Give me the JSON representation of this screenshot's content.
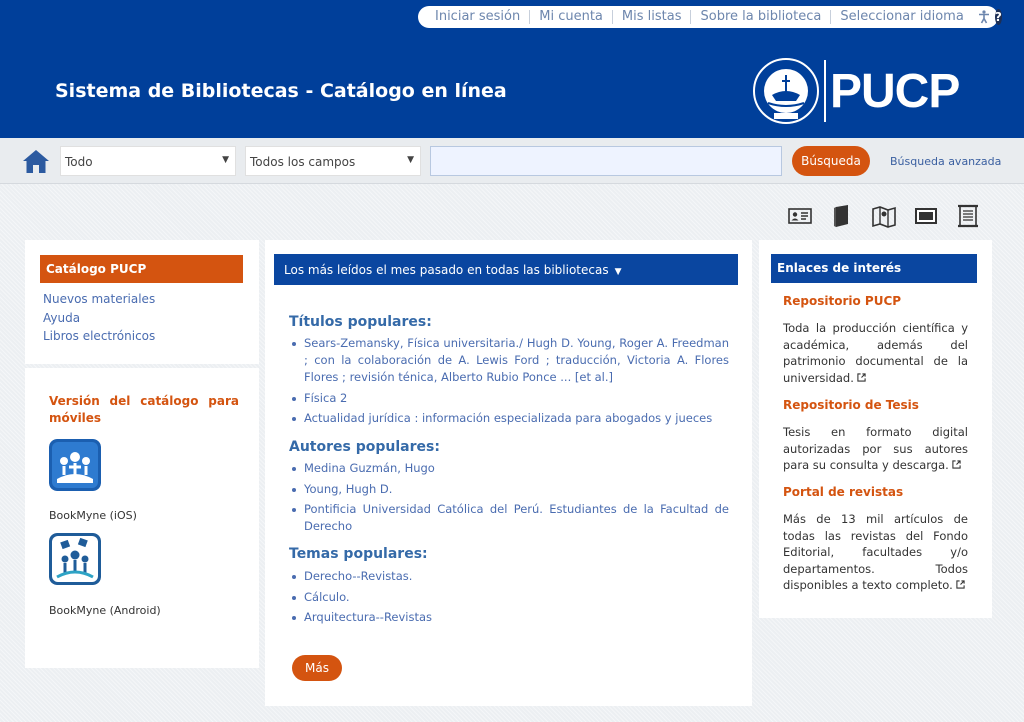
{
  "header": {
    "util_links": [
      "Iniciar sesión",
      "Mi cuenta",
      "Mis listas",
      "Sobre la biblioteca",
      "Seleccionar idioma"
    ],
    "title": "Sistema de Bibliotecas - Catálogo en línea",
    "logo_text": "PUCP"
  },
  "search": {
    "scope_selected": "Todo",
    "field_selected": "Todos los campos",
    "query_value": "",
    "button_label": "Búsqueda",
    "advanced_label": "Búsqueda avanzada"
  },
  "format_icons": [
    "id-card-icon",
    "book-icon",
    "map-icon",
    "video-icon",
    "scroll-icon"
  ],
  "left_menu": {
    "header": "Catálogo PUCP",
    "items": [
      "Nuevos materiales",
      "Ayuda",
      "Libros electrónicos"
    ]
  },
  "mobile": {
    "title": "Versión del catálogo para móviles",
    "apps": [
      {
        "label": "BookMyne (iOS)"
      },
      {
        "label": "BookMyne (Android)"
      }
    ]
  },
  "popular": {
    "header": "Los más leídos el mes pasado en todas las bibliotecas",
    "titles_heading": "Títulos populares:",
    "titles": [
      "Sears-Zemansky, Física universitaria./ Hugh D. Young, Roger A. Freedman ; con la colaboración de A. Lewis Ford ; traducción, Victoria A. Flores Flores ; revisión ténica, Alberto Rubio Ponce ... [et al.]",
      "Física 2",
      "Actualidad jurídica : información especializada para abogados y jueces"
    ],
    "authors_heading": "Autores populares:",
    "authors": [
      "Medina Guzmán, Hugo",
      "Young, Hugh D.",
      "Pontificia Universidad Católica del Perú. Estudiantes de la Facultad de Derecho"
    ],
    "subjects_heading": "Temas populares:",
    "subjects": [
      "Derecho--Revistas.",
      "Cálculo.",
      "Arquitectura--Revistas"
    ],
    "more_label": "Más"
  },
  "links": {
    "header": "Enlaces de interés",
    "items": [
      {
        "title": "Repositorio PUCP",
        "desc": "Toda la producción científica y académica, además del patrimonio documental de la universidad."
      },
      {
        "title": "Repositorio de Tesis",
        "desc": "Tesis en formato digital autorizadas por sus autores para su consulta y descarga."
      },
      {
        "title": "Portal de revistas",
        "desc": "Más de 13 mil artículos de todas las revistas del Fondo Editorial, facultades y/o departamentos. Todos disponibles a texto completo."
      }
    ]
  },
  "colors": {
    "brand_blue": "#003f9a",
    "accent_orange": "#d45410",
    "link_blue": "#4a6cb0"
  }
}
